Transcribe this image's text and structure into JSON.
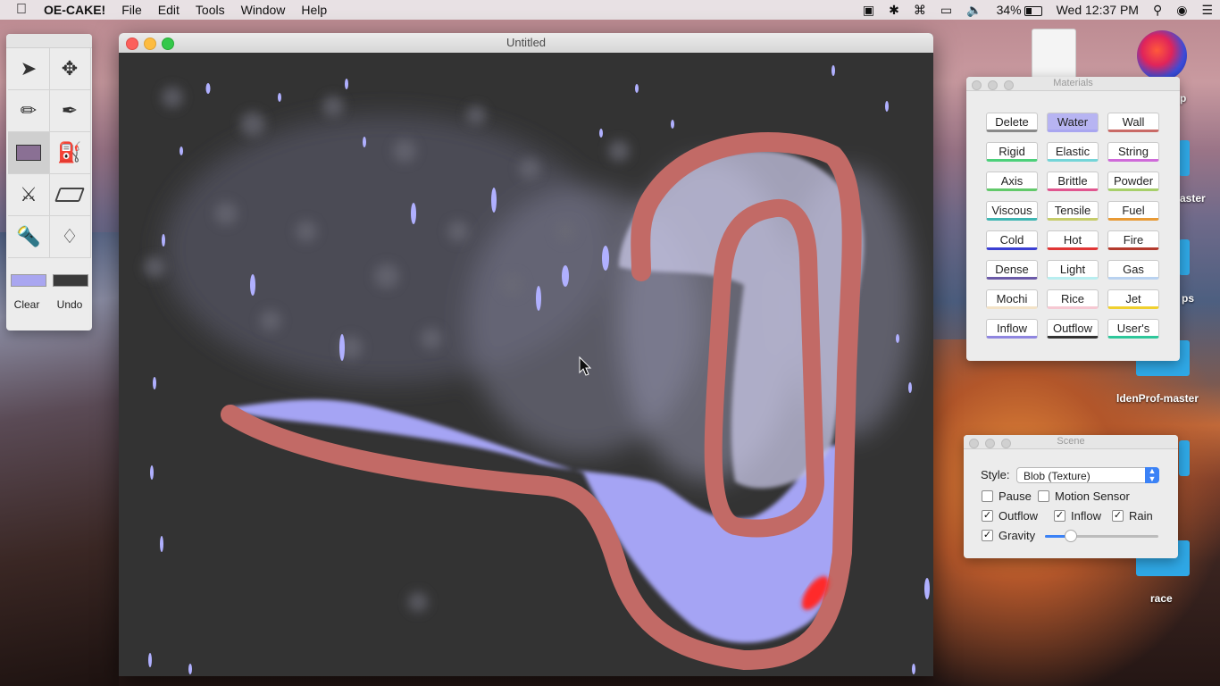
{
  "menubar": {
    "app_name": "OE-CAKE!",
    "menus": [
      "File",
      "Edit",
      "Tools",
      "Window",
      "Help"
    ],
    "battery": "34%",
    "clock": "Wed 12:37 PM"
  },
  "tool_palette": {
    "tools": [
      "select-arrow-icon",
      "move-icon",
      "pencil-icon",
      "brush-icon",
      "rectangle-icon",
      "fill-bucket-icon",
      "knife-icon",
      "eraser-icon",
      "flashlight-icon",
      "dropper-icon"
    ],
    "selected_tool": "rectangle-icon",
    "foreground_color": "#a9a6f0",
    "background_color": "#3a3a3a",
    "clear_label": "Clear",
    "undo_label": "Undo"
  },
  "main_window": {
    "title": "Untitled"
  },
  "materials": {
    "title": "Materials",
    "selected": "Water",
    "buttons": [
      {
        "label": "Delete",
        "color": "#8a8a8a"
      },
      {
        "label": "Water",
        "color": "#a9a6f0"
      },
      {
        "label": "Wall",
        "color": "#c96a66"
      },
      {
        "label": "Rigid",
        "color": "#4cd07a"
      },
      {
        "label": "Elastic",
        "color": "#74d5d8"
      },
      {
        "label": "String",
        "color": "#cf6ad9"
      },
      {
        "label": "Axis",
        "color": "#62c96a"
      },
      {
        "label": "Brittle",
        "color": "#e0568f"
      },
      {
        "label": "Powder",
        "color": "#a7cf6a"
      },
      {
        "label": "Viscous",
        "color": "#3fb6b3"
      },
      {
        "label": "Tensile",
        "color": "#c6cc6a"
      },
      {
        "label": "Fuel",
        "color": "#e89a35"
      },
      {
        "label": "Cold",
        "color": "#3b3fd2"
      },
      {
        "label": "Hot",
        "color": "#e03535"
      },
      {
        "label": "Fire",
        "color": "#b33a2d"
      },
      {
        "label": "Dense",
        "color": "#6b5aa8"
      },
      {
        "label": "Light",
        "color": "#b8eef0"
      },
      {
        "label": "Gas",
        "color": "#b9d2f0"
      },
      {
        "label": "Mochi",
        "color": "#f3e2c7"
      },
      {
        "label": "Rice",
        "color": "#f6c8d2"
      },
      {
        "label": "Jet",
        "color": "#f0d02e"
      },
      {
        "label": "Inflow",
        "color": "#8f86e0"
      },
      {
        "label": "Outflow",
        "color": "#333333"
      },
      {
        "label": "User's",
        "color": "#2ec79a"
      }
    ]
  },
  "scene": {
    "title": "Scene",
    "style_label": "Style:",
    "style_value": "Blob (Texture)",
    "pause_label": "Pause",
    "pause_checked": false,
    "motion_label": "Motion Sensor",
    "motion_checked": false,
    "outflow_label": "Outflow",
    "outflow_checked": true,
    "inflow_label": "Inflow",
    "inflow_checked": true,
    "rain_label": "Rain",
    "rain_checked": true,
    "gravity_label": "Gravity",
    "gravity_checked": true,
    "gravity_level": 0.22
  },
  "desktop": {
    "items": [
      {
        "label": "p"
      },
      {
        "label": "aster"
      },
      {
        "label": "ps"
      },
      {
        "label": "ldenProf-master"
      },
      {
        "label": "race"
      }
    ]
  }
}
